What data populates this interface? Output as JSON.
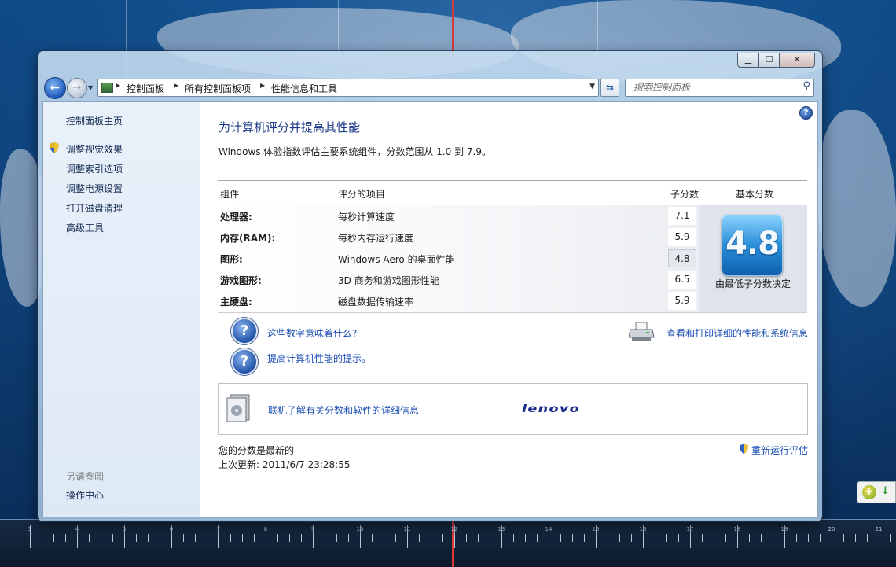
{
  "window": {
    "controls": {
      "minimize": "▁",
      "maximize": "☐",
      "close": "✕"
    }
  },
  "address": {
    "crumbs": [
      "控制面板",
      "所有控制面板项",
      "性能信息和工具"
    ],
    "search_placeholder": "搜索控制面板"
  },
  "nav": {
    "home": "控制面板主页",
    "items": [
      "调整视觉效果",
      "调整索引选项",
      "调整电源设置",
      "打开磁盘清理",
      "高级工具"
    ],
    "see_also_label": "另请参阅",
    "see_also_items": [
      "操作中心"
    ]
  },
  "main": {
    "title": "为计算机评分并提高其性能",
    "subtitle": "Windows 体验指数评估主要系统组件，分数范围从 1.0 到 7.9。",
    "table": {
      "headers": {
        "component": "组件",
        "rated": "评分的项目",
        "subscore": "子分数",
        "base": "基本分数"
      },
      "rows": [
        {
          "component": "处理器:",
          "description": "每秒计算速度",
          "subscore": "7.1"
        },
        {
          "component": "内存(RAM):",
          "description": "每秒内存运行速度",
          "subscore": "5.9"
        },
        {
          "component": "图形:",
          "description": "Windows Aero 的桌面性能",
          "subscore": "4.8"
        },
        {
          "component": "游戏图形:",
          "description": "3D 商务和游戏图形性能",
          "subscore": "6.5"
        },
        {
          "component": "主硬盘:",
          "description": "磁盘数据传输速率",
          "subscore": "5.9"
        }
      ],
      "base_score": "4.8",
      "base_caption": "由最低子分数决定"
    },
    "links": {
      "what_numbers_mean": "这些数字意味着什么?",
      "improve_tips": "提高计算机性能的提示。",
      "print_details": "查看和打印详细的性能和系统信息",
      "online_info": "联机了解有关分数和软件的详细信息"
    },
    "oem_logo": "lenovo",
    "status": "您的分数是最新的",
    "last_update": "上次更新: 2011/6/7 23:28:55",
    "rerun": "重新运行评估"
  },
  "taskbar_ruler": {
    "labels": [
      "3",
      "4",
      "5",
      "6",
      "7",
      "8",
      "9",
      "10",
      "11",
      "12",
      "13",
      "14",
      "15",
      "16",
      "17",
      "18",
      "19",
      "20",
      "21"
    ]
  },
  "colors": {
    "link": "#1a4eb3",
    "title": "#1e3b8a",
    "base_tile": "#2a8ed8"
  }
}
